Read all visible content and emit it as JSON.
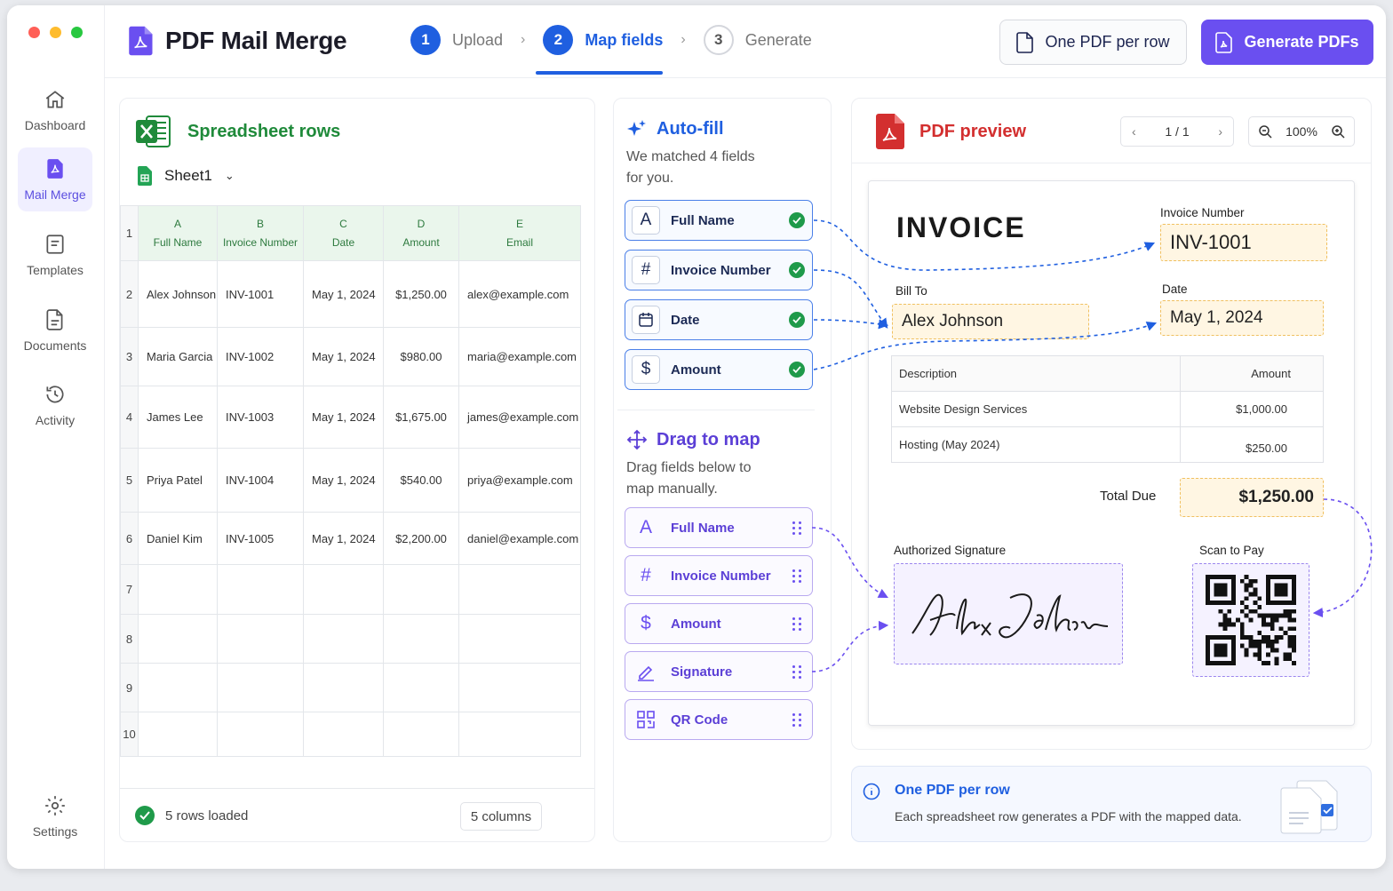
{
  "app": {
    "title": "PDF Mail Merge"
  },
  "nav": {
    "items": [
      {
        "label": "Dashboard",
        "icon": "home-icon"
      },
      {
        "label": "Mail Merge",
        "icon": "pdf-file-icon"
      },
      {
        "label": "Templates",
        "icon": "template-icon"
      },
      {
        "label": "Documents",
        "icon": "document-icon"
      },
      {
        "label": "Activity",
        "icon": "history-icon"
      }
    ],
    "settings": "Settings"
  },
  "steps": [
    {
      "num": "1",
      "label": "Upload",
      "state": "done"
    },
    {
      "num": "2",
      "label": "Map fields",
      "state": "current"
    },
    {
      "num": "3",
      "label": "Generate",
      "state": "todo"
    }
  ],
  "toolbar": {
    "one_pdf": "One PDF per row",
    "generate": "Generate PDFs"
  },
  "sheet": {
    "title": "Spreadsheet rows",
    "sheet_name": "Sheet1",
    "col_letters": [
      "A",
      "B",
      "C",
      "D",
      "E"
    ],
    "headers": [
      "Full Name",
      "Invoice Number",
      "Date",
      "Amount",
      "Email"
    ],
    "rows": [
      [
        "Alex Johnson",
        "INV-1001",
        "May 1, 2024",
        "$1,250.00",
        "alex@example.com"
      ],
      [
        "Maria Garcia",
        "INV-1002",
        "May 1, 2024",
        "$980.00",
        "maria@example.com"
      ],
      [
        "James Lee",
        "INV-1003",
        "May 1, 2024",
        "$1,675.00",
        "james@example.com"
      ],
      [
        "Priya Patel",
        "INV-1004",
        "May 1, 2024",
        "$540.00",
        "priya@example.com"
      ],
      [
        "Daniel Kim",
        "INV-1005",
        "May 1, 2024",
        "$2,200.00",
        "daniel@example.com"
      ]
    ],
    "row_numbers": [
      "1",
      "2",
      "3",
      "4",
      "5",
      "6",
      "7",
      "8",
      "9",
      "10"
    ],
    "status": "5 rows loaded",
    "columns": "5 columns"
  },
  "autofill": {
    "title": "Auto-fill",
    "desc_line1": "We matched 4 fields",
    "desc_line2": "for you.",
    "fields": [
      {
        "icon": "A",
        "label": "Full Name"
      },
      {
        "icon": "#",
        "label": "Invoice Number"
      },
      {
        "icon": "cal",
        "label": "Date"
      },
      {
        "icon": "$",
        "label": "Amount"
      }
    ]
  },
  "dragmap": {
    "title": "Drag to map",
    "desc_line1": "Drag fields below to",
    "desc_line2": "map manually.",
    "fields": [
      {
        "icon": "A",
        "label": "Full Name"
      },
      {
        "icon": "#",
        "label": "Invoice Number"
      },
      {
        "icon": "$",
        "label": "Amount"
      },
      {
        "icon": "sig",
        "label": "Signature"
      },
      {
        "icon": "qr",
        "label": "QR Code"
      }
    ]
  },
  "preview": {
    "title": "PDF preview",
    "page": "1 / 1",
    "zoom": "100%",
    "doc": {
      "heading": "INVOICE",
      "invoice_number_label": "Invoice Number",
      "invoice_number": "INV-1001",
      "bill_to_label": "Bill To",
      "bill_to": "Alex Johnson",
      "date_label": "Date",
      "date": "May 1, 2024",
      "items_header": [
        "Description",
        "Amount"
      ],
      "items": [
        [
          "Website Design Services",
          "$1,000.00"
        ],
        [
          "Hosting (May 2024)",
          "$250.00"
        ]
      ],
      "total_label": "Total Due",
      "total": "$1,250.00",
      "signature_label": "Authorized Signature",
      "signature_name": "Alex Johnson",
      "scan_label": "Scan to Pay"
    }
  },
  "info": {
    "title": "One PDF per row",
    "text": "Each spreadsheet row generates a PDF with the mapped data."
  },
  "colors": {
    "accent": "#6a4ff0",
    "primary_blue": "#1f5fe0",
    "excel_green": "#1f8a3a"
  }
}
